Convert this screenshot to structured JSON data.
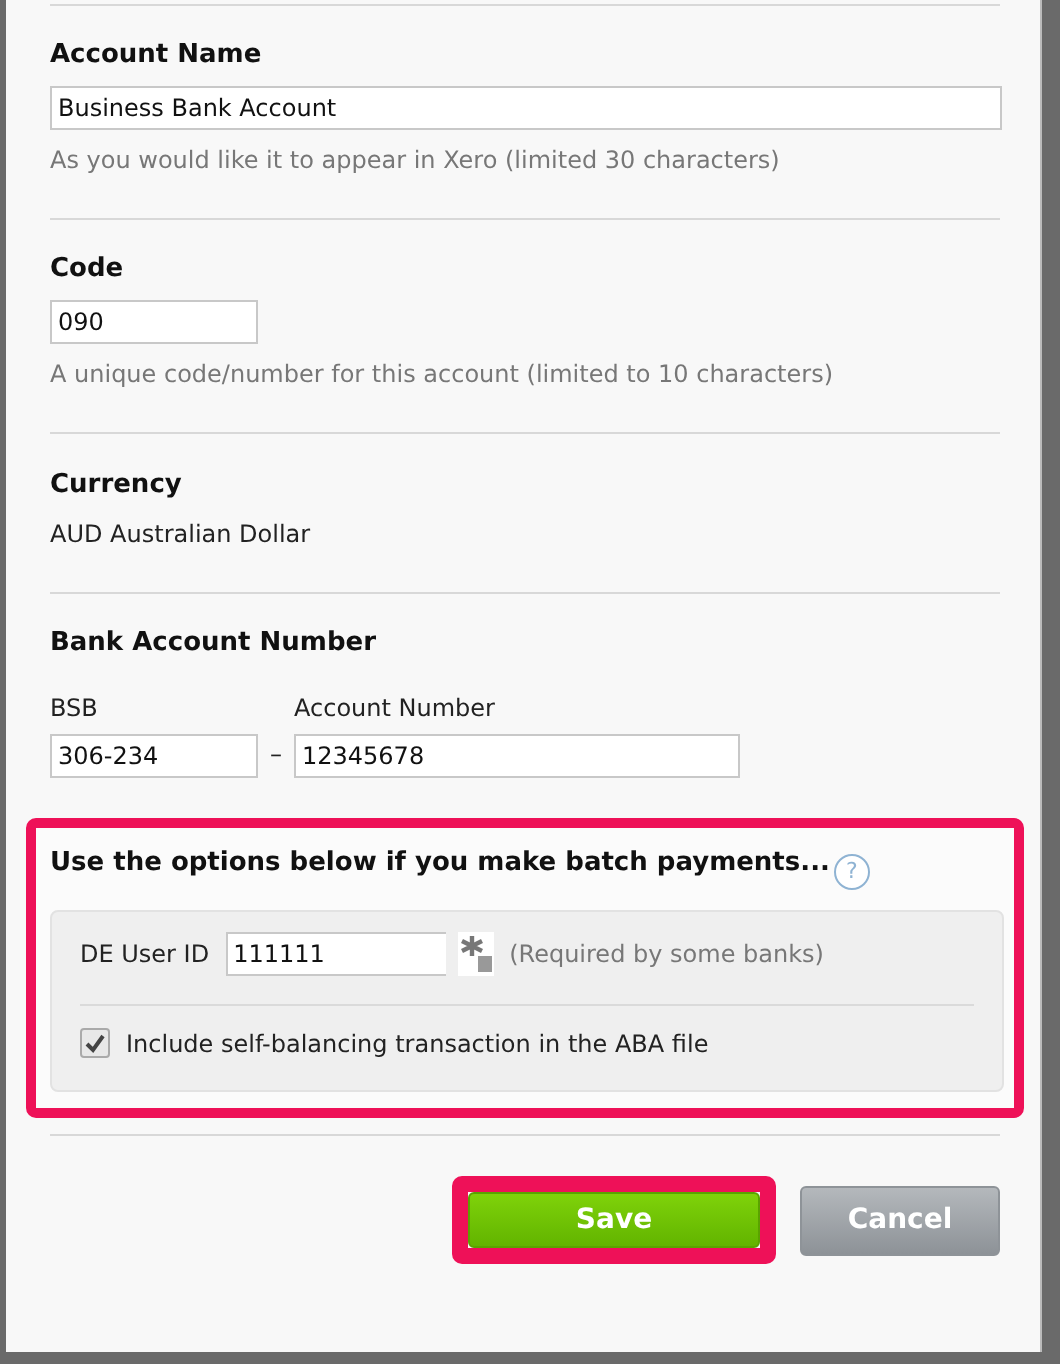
{
  "account_name": {
    "label": "Account Name",
    "value": "Business Bank Account",
    "hint": "As you would like it to appear in Xero (limited 30 characters)"
  },
  "code": {
    "label": "Code",
    "value": "090",
    "hint": "A unique code/number for this account (limited to 10 characters)"
  },
  "currency": {
    "label": "Currency",
    "value": "AUD Australian Dollar"
  },
  "bank_account_number": {
    "label": "Bank Account Number",
    "bsb": {
      "label": "BSB",
      "value": "306-234"
    },
    "separator": "–",
    "account_number": {
      "label": "Account Number",
      "value": "12345678"
    }
  },
  "batch_payments": {
    "heading": "Use the options below if you make batch payments...",
    "help": "?",
    "highlighted": true,
    "de_user_id": {
      "label": "DE User ID",
      "value": "111111",
      "note": "(Required by some banks)"
    },
    "self_balancing": {
      "label": "Include self-balancing transaction in the ABA file",
      "checked": true
    }
  },
  "buttons": [
    {
      "kind": "primary",
      "label": "Save",
      "highlighted": true
    },
    {
      "kind": "secondary",
      "label": "Cancel",
      "highlighted": false
    }
  ]
}
